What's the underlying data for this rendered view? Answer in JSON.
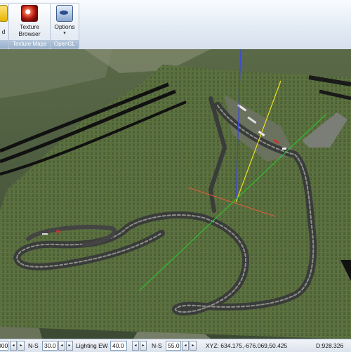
{
  "ribbon": {
    "partial_button_label": "d",
    "groups": [
      {
        "label": "",
        "buttons": []
      },
      {
        "label": "Texture Maps",
        "buttons": [
          {
            "line1": "Texture",
            "line2": "Browser"
          }
        ]
      },
      {
        "label": "OpenGL",
        "buttons": [
          {
            "line1": "Options",
            "line2": "▾"
          }
        ]
      }
    ]
  },
  "status": {
    "first_value": "000",
    "ns_label_1": "N-S",
    "ns_value_1": "30.0",
    "lighting_label": "Lighting EW",
    "lighting_value": "40.0",
    "ns_label_2": "N-S",
    "ns_value_2": "55.0",
    "xyz": "XYZ: 634.175,-676.069,50.425",
    "distance": "D:928.326"
  },
  "icons": {
    "texture_browser": "texture-browser-icon",
    "options": "opengl-options-icon"
  },
  "axis_colors": {
    "x": "#e05a3a",
    "y": "#2fbf2f",
    "z": "#3b49d8",
    "view": "#f0e020"
  }
}
